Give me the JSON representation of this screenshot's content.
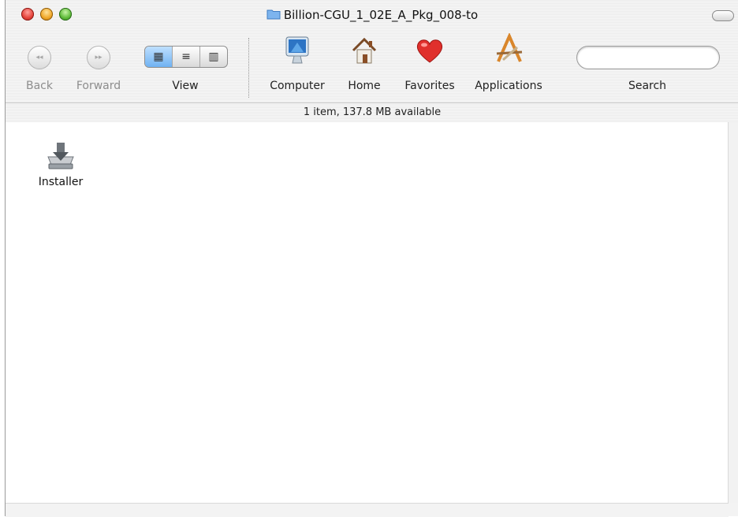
{
  "window": {
    "title": "Billion-CGU_1_02E_A_Pkg_008-to"
  },
  "toolbar": {
    "back_label": "Back",
    "forward_label": "Forward",
    "view_label": "View",
    "computer_label": "Computer",
    "home_label": "Home",
    "favorites_label": "Favorites",
    "applications_label": "Applications",
    "search_label": "Search",
    "search_placeholder": ""
  },
  "status": {
    "text": "1 item, 137.8 MB available"
  },
  "files": [
    {
      "name": "Installer",
      "icon": "installer-icon"
    }
  ],
  "colors": {
    "accent_blue": "#6fb2f2",
    "close_red": "#e5433a",
    "minimize_amber": "#f0a728",
    "zoom_green": "#5fbb3a"
  }
}
